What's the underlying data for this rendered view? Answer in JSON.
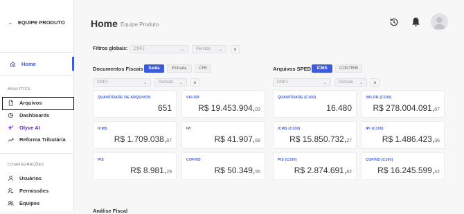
{
  "sidebar": {
    "team_name": "EQUIPE PRODUTO",
    "home": {
      "label": "Home",
      "icon": "home-icon"
    },
    "sections": [
      {
        "label": "ANALYTICS",
        "items": [
          {
            "label": "Arquivos",
            "icon": "file-icon"
          },
          {
            "label": "Dashboards",
            "icon": "pie-chart-icon"
          },
          {
            "label": "Olyve AI",
            "icon": "sparkle-icon"
          },
          {
            "label": "Reforma Tributária",
            "icon": "trend-icon"
          }
        ]
      },
      {
        "label": "CONFIGURAÇÕES",
        "items": [
          {
            "label": "Usuários",
            "icon": "user-icon"
          },
          {
            "label": "Permissões",
            "icon": "user-key-icon"
          },
          {
            "label": "Equipes",
            "icon": "users-icon"
          }
        ]
      }
    ],
    "accent": "#3d5bd9"
  },
  "header": {
    "title": "Home",
    "subtitle": "Equipe Produto"
  },
  "global_filters": {
    "label": "Filtros globais:",
    "cnpj_placeholder": "CNPJ",
    "period_placeholder": "Período"
  },
  "fiscal": {
    "title": "Documentos Fiscais",
    "tabs": [
      "Saída",
      "Entrada",
      "CFE"
    ],
    "active_tab": "Saída",
    "cnpj_placeholder": "CNPJ",
    "period_placeholder": "Período",
    "cards": [
      {
        "label": "QUANTIDADE DE ARQUIVOS",
        "main": "651",
        "cents": ""
      },
      {
        "label": "VALOR",
        "main": "R$ 19.453.904,",
        "cents": "03"
      },
      {
        "label": "ICMS",
        "main": "R$ 1.709.038,",
        "cents": "87"
      },
      {
        "label": "IPI",
        "main": "R$ 41.907,",
        "cents": "68"
      },
      {
        "label": "PIS",
        "main": "R$ 8.981,",
        "cents": "29"
      },
      {
        "label": "COFINS",
        "main": "R$ 50.349,",
        "cents": "55"
      }
    ]
  },
  "sped": {
    "title": "Arquivos SPED",
    "tabs": [
      "ICMS",
      "CONTRIB"
    ],
    "active_tab": "ICMS",
    "cnpj_placeholder": "CNPJ",
    "period_placeholder": "Período",
    "cards": [
      {
        "label": "QUANTIDADE (C100)",
        "main": "16.480",
        "cents": ""
      },
      {
        "label": "VALOR (C100)",
        "main": "R$ 278.004.091,",
        "cents": "67"
      },
      {
        "label": "ICMS (C100)",
        "main": "R$ 15.850.732,",
        "cents": "27"
      },
      {
        "label": "IPI (C100)",
        "main": "R$ 1.486.423,",
        "cents": "36"
      },
      {
        "label": "PIS (C100)",
        "main": "R$ 2.874.691,",
        "cents": "82"
      },
      {
        "label": "COFINS (C100)",
        "main": "R$ 16.245.599,",
        "cents": "42"
      }
    ]
  },
  "cut_off_section_title": "Análise Fiscal"
}
